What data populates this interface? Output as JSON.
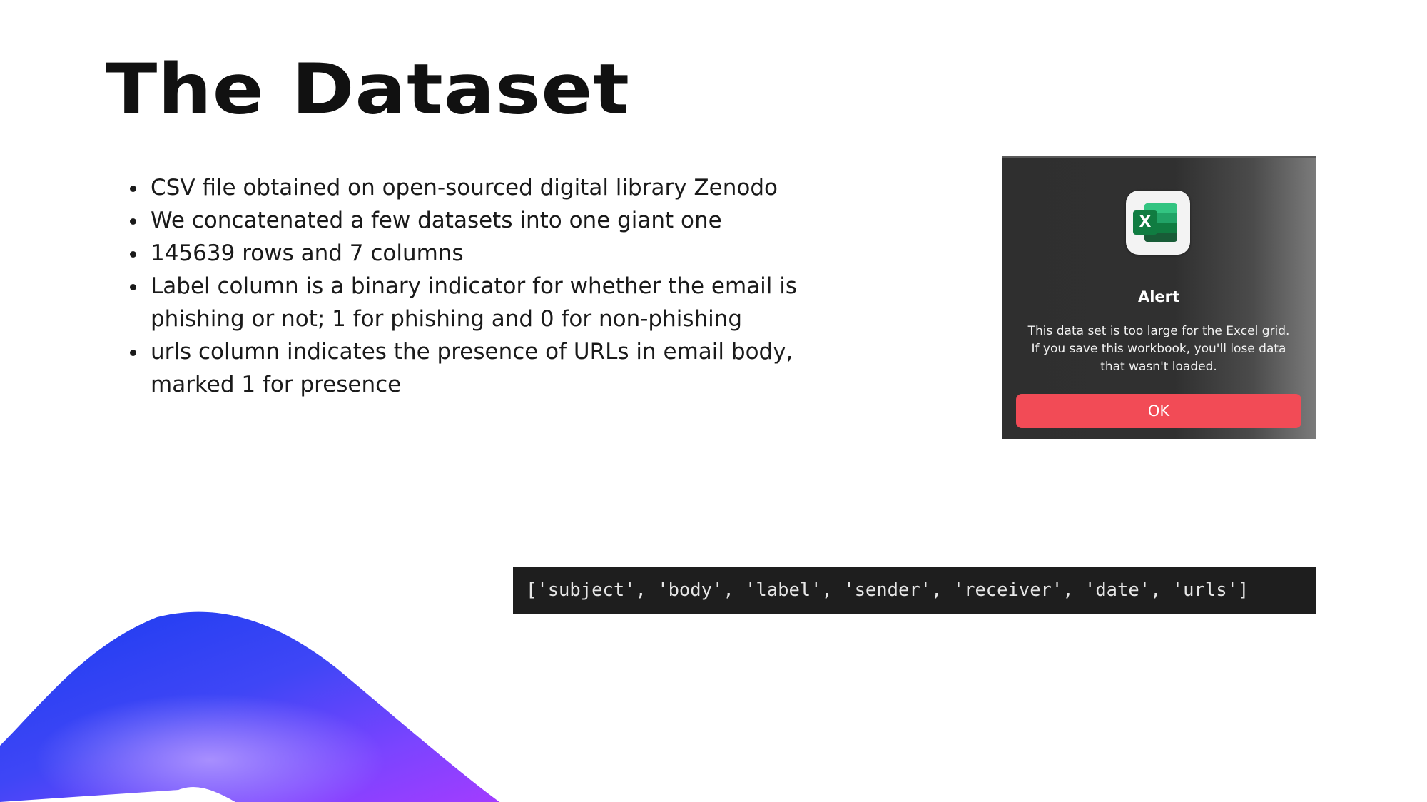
{
  "slide": {
    "title": "The Dataset",
    "bullets": [
      "CSV file obtained on open-sourced digital library Zenodo",
      "We concatenated a few datasets into one giant one",
      "145639 rows and 7 columns",
      "Label column is a binary indicator for whether the email is phishing or not; 1 for phishing and 0 for non-phishing",
      "urls column indicates the presence of URLs in email body, marked 1 for presence"
    ]
  },
  "alert_dialog": {
    "app_icon": "microsoft-excel-icon",
    "icon_letter": "X",
    "title": "Alert",
    "message": "This data set is too large for the Excel grid.  If you save this workbook, you'll lose data that wasn't loaded.",
    "ok_label": "OK",
    "ok_color": "#f24b56"
  },
  "code_output": {
    "text": "['subject', 'body', 'label', 'sender', 'receiver', 'date', 'urls']"
  },
  "decoration": {
    "wave_colors": [
      "#1a3cf0",
      "#6a4bff",
      "#a23cff"
    ]
  }
}
